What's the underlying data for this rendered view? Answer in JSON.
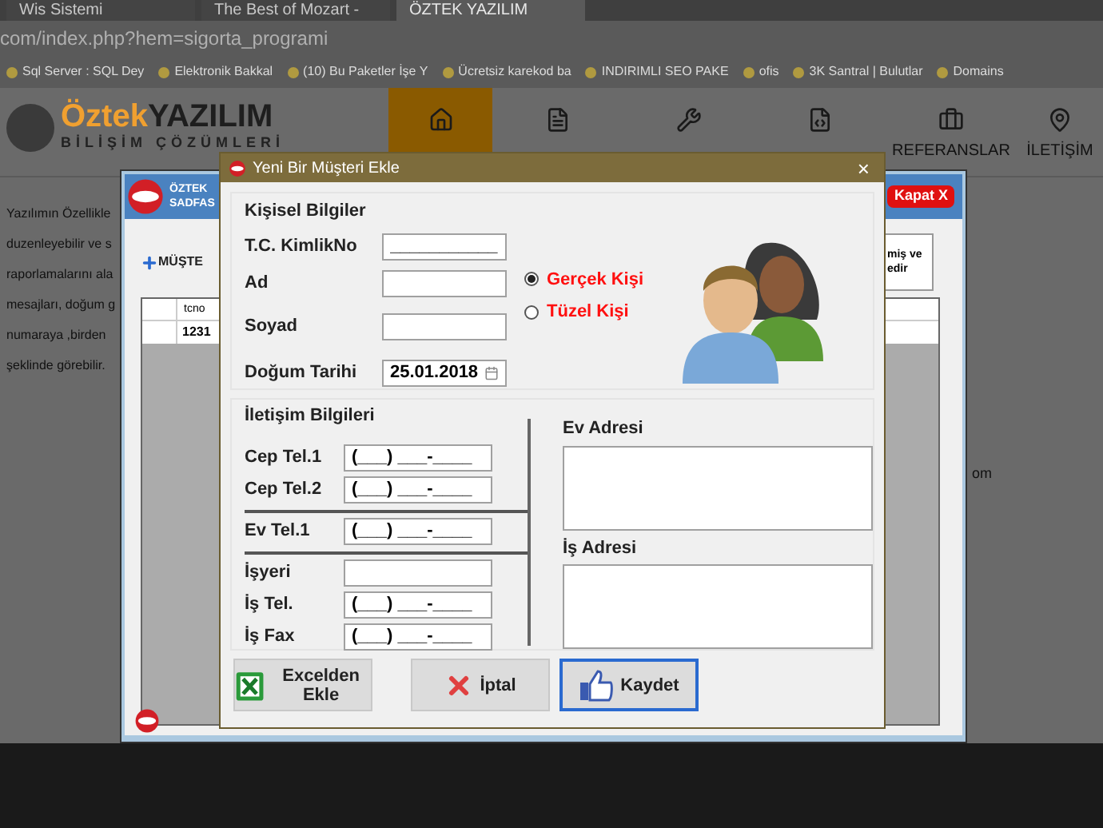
{
  "browser": {
    "tabs": [
      {
        "title": "Wis Sistemi",
        "selected": false
      },
      {
        "title": "The Best of Mozart -",
        "selected": false
      },
      {
        "title": "ÖZTEK YAZILIM",
        "selected": true
      }
    ],
    "address": "com/index.php?hem=sigorta_programi",
    "bookmarks": [
      "Sql Server : SQL Dey",
      "Elektronik Bakkal",
      "(10) Bu Paketler İşe Y",
      "Ücretsiz karekod ba",
      "INDIRIMLI SEO PAKE",
      "ofis",
      "3K Santral | Bulutlar",
      "Domains"
    ]
  },
  "site": {
    "logo": {
      "name_a": "Öztek",
      "name_b": "YAZILIM",
      "tagline": "BİLİŞİM ÇÖZÜMLERİ"
    },
    "nav": [
      {
        "selected": true
      },
      {
        "selected": false
      },
      {
        "selected": false
      },
      {
        "selected": false
      },
      {
        "label": "REFERANSLAR",
        "selected": false
      },
      {
        "label": "İLETİŞİM",
        "selected": false
      }
    ],
    "body_lines": [
      "Yazılımın Özellikle",
      "duzenleyebilir ve s",
      "raporlamalarını ala",
      "mesajları, doğum g",
      "numaraya ,birden",
      "şeklinde görebilir."
    ],
    "right_text": "om"
  },
  "app_window": {
    "title_a": "ÖZTEK",
    "title_b": "SADFAS",
    "close": "Kapat X",
    "toolbar_button": "MÜŞTE",
    "info_lines": [
      "miş ve",
      "edir"
    ],
    "grid": {
      "column": "tcno",
      "cell": "1231"
    }
  },
  "dialog": {
    "title": "Yeni Bir Müşteri Ekle",
    "close": "×",
    "personal": {
      "title": "Kişisel Bilgiler",
      "fields": [
        {
          "label": "T.C. KimlikNo",
          "value": "___________"
        },
        {
          "label": "Ad"
        },
        {
          "label": "Soyad"
        }
      ],
      "birth": {
        "label": "Doğum Tarihi",
        "value": "25.01.2018"
      },
      "types": [
        {
          "label": "Gerçek Kişi",
          "selected": true
        },
        {
          "label": "Tüzel Kişi",
          "selected": false
        }
      ]
    },
    "contact": {
      "title": "İletişim Bilgileri",
      "groups": [
        [
          {
            "label": "Cep Tel.1",
            "value": "(___) ___-____"
          },
          {
            "label": "Cep Tel.2",
            "value": "(___) ___-____"
          }
        ],
        [
          {
            "label": "Ev Tel.1",
            "value": "(___) ___-____"
          }
        ],
        [
          {
            "label": "İşyeri"
          },
          {
            "label": "İş Tel.",
            "value": "(___) ___-____"
          },
          {
            "label": "İş Fax",
            "value": "(___) ___-____"
          }
        ]
      ],
      "addresses": [
        "Ev Adresi",
        "İş Adresi"
      ]
    },
    "buttons": [
      {
        "kind": "excel",
        "label": "Excelden Ekle",
        "selected": false
      },
      {
        "kind": "cancel",
        "label": "İptal",
        "selected": false
      },
      {
        "kind": "save",
        "label": "Kaydet",
        "selected": true
      }
    ]
  }
}
